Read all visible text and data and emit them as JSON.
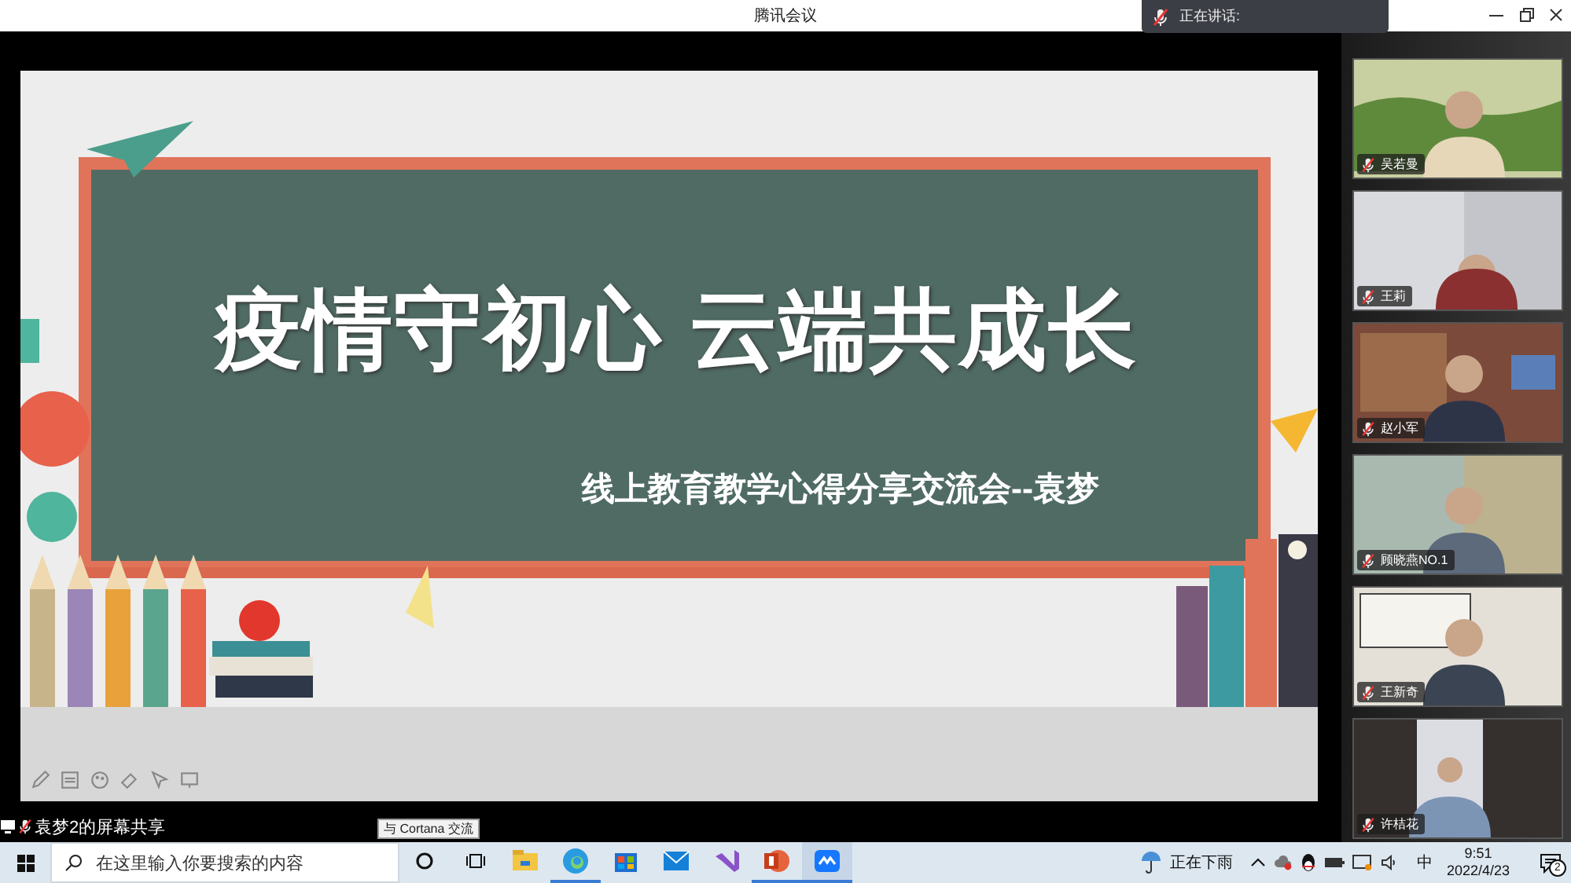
{
  "window": {
    "title": "腾讯会议"
  },
  "speaking_bar": {
    "label": "正在讲话:"
  },
  "slide": {
    "title": "疫情守初心 云端共成长",
    "subtitle": "线上教育教学心得分享交流会--袁梦"
  },
  "share_label": "袁梦2的屏幕共享",
  "participants": [
    {
      "name": "吴若曼",
      "muted": true
    },
    {
      "name": "王莉",
      "muted": true
    },
    {
      "name": "赵小军",
      "muted": true
    },
    {
      "name": "顾晓燕NO.1",
      "muted": true
    },
    {
      "name": "王新奇",
      "muted": true
    },
    {
      "name": "许桔花",
      "muted": true
    }
  ],
  "taskbar": {
    "search": {
      "placeholder": "在这里输入你要搜索的内容"
    },
    "tooltip": "与 Cortana 交流",
    "apps": [
      {
        "kind": "explorer",
        "running": false,
        "selected": false
      },
      {
        "kind": "edge",
        "running": true,
        "selected": false
      },
      {
        "kind": "store",
        "running": false,
        "selected": false
      },
      {
        "kind": "mail",
        "running": false,
        "selected": false
      },
      {
        "kind": "vs",
        "running": false,
        "selected": false
      },
      {
        "kind": "ppt",
        "running": true,
        "selected": false
      },
      {
        "kind": "meeting",
        "running": true,
        "selected": true
      }
    ],
    "weather": "正在下雨",
    "ime": "中",
    "time": "9:51",
    "date": "2022/4/23",
    "notifications": "2"
  }
}
